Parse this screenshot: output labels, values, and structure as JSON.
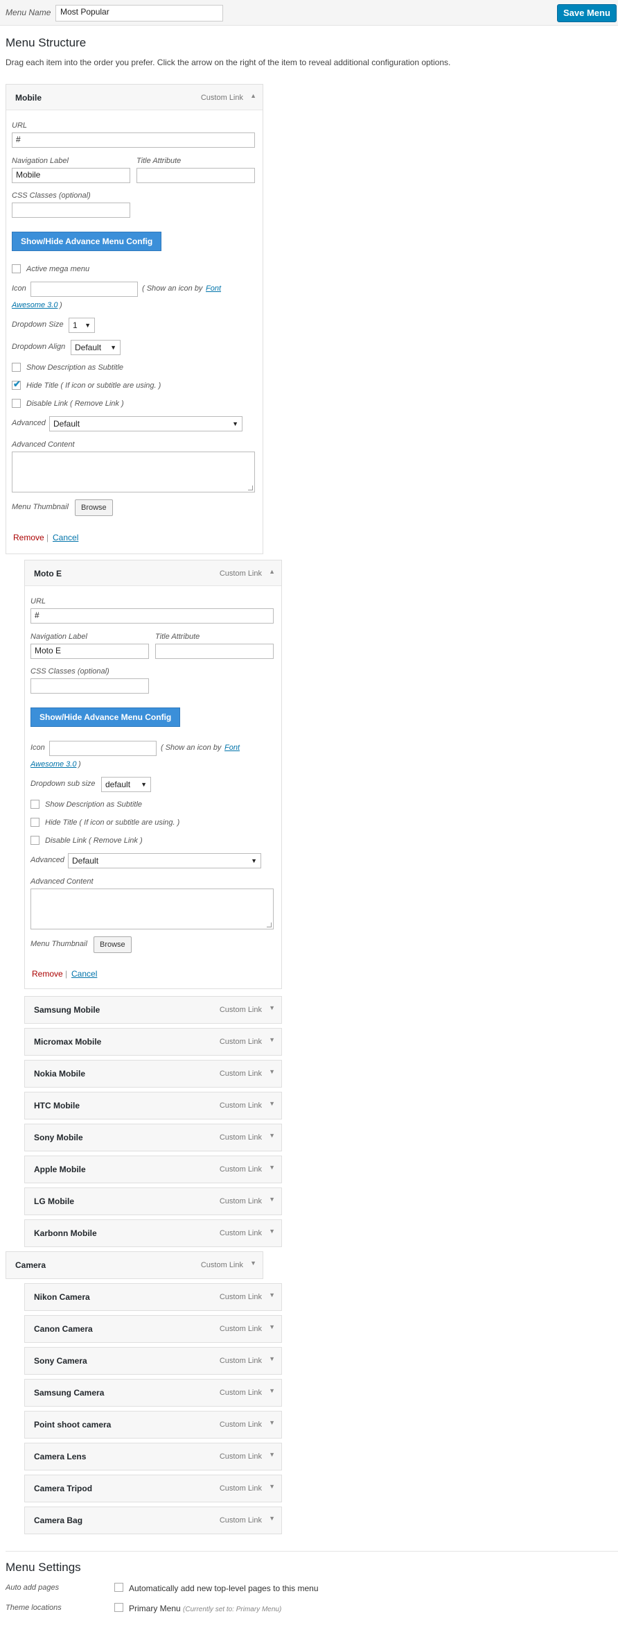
{
  "header": {
    "menu_name_label": "Menu Name",
    "menu_name_value": "Most Popular",
    "save_label": "Save Menu"
  },
  "structure": {
    "title": "Menu Structure",
    "instructions": "Drag each item into the order you prefer. Click the arrow on the right of the item to reveal additional configuration options."
  },
  "labels": {
    "custom_link": "Custom Link",
    "url": "URL",
    "nav_label": "Navigation Label",
    "title_attr": "Title Attribute",
    "css_classes": "CSS Classes (optional)",
    "toggle_btn": "Show/Hide Advance Menu Config",
    "active_mega": "Active mega menu",
    "icon": "Icon",
    "icon_hint_pre": "( Show an icon by",
    "icon_link_1": "Font",
    "icon_link_2": "Awesome 3.0",
    "icon_hint_post": ")",
    "dropdown_size": "Dropdown Size",
    "dropdown_sub_size": "Dropdown sub size",
    "dropdown_align": "Dropdown Align",
    "show_desc": "Show Description as Subtitle",
    "hide_title": "Hide Title ( If icon or subtitle are using. )",
    "disable_link": "Disable Link ( Remove Link )",
    "advanced": "Advanced",
    "advanced_content": "Advanced Content",
    "menu_thumbnail": "Menu Thumbnail",
    "browse": "Browse",
    "remove": "Remove",
    "separator": "|",
    "cancel": "Cancel"
  },
  "item_mobile": {
    "title": "Mobile",
    "url": "#",
    "nav_label": "Mobile",
    "dropdown_size": "1",
    "dropdown_align": "Default",
    "advanced": "Default",
    "hide_title_checked": true
  },
  "item_moto": {
    "title": "Moto E",
    "url": "#",
    "nav_label": "Moto E",
    "dropdown_sub_size": "default",
    "advanced": "Default"
  },
  "mobile_children": [
    "Samsung Mobile",
    "Micromax Mobile",
    "Nokia Mobile",
    "HTC Mobile",
    "Sony Mobile",
    "Apple Mobile",
    "LG Mobile",
    "Karbonn Mobile"
  ],
  "camera": {
    "title": "Camera"
  },
  "camera_children": [
    "Nikon Camera",
    "Canon Camera",
    "Sony Camera",
    "Samsung Camera",
    "Point shoot camera",
    "Camera Lens",
    "Camera Tripod",
    "Camera Bag"
  ],
  "settings": {
    "title": "Menu Settings",
    "auto_add_label": "Auto add pages",
    "auto_add_text": "Automatically add new top-level pages to this menu",
    "theme_locations_label": "Theme locations",
    "primary_menu": "Primary Menu",
    "primary_note": "(Currently set to: Primary Menu)"
  }
}
